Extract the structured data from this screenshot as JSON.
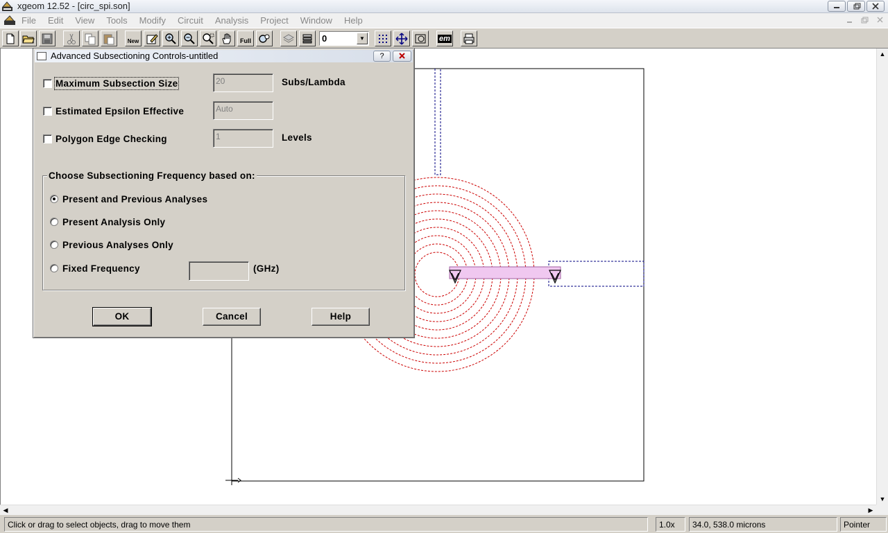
{
  "window": {
    "title": "xgeom 12.52 - [circ_spi.son]"
  },
  "menu": {
    "items": [
      "File",
      "Edit",
      "View",
      "Tools",
      "Modify",
      "Circuit",
      "Analysis",
      "Project",
      "Window",
      "Help"
    ]
  },
  "toolbar": {
    "zoom_value": "0",
    "new_label": "New",
    "full_label": "Full",
    "em_label": "em"
  },
  "dialog": {
    "title": "Advanced Subsectioning Controls-untitled",
    "help_glyph": "?",
    "options": [
      {
        "label": "Maximum Subsection Size",
        "value": "20",
        "unit": "Subs/Lambda",
        "checked": false
      },
      {
        "label": "Estimated Epsilon Effective",
        "value": "Auto",
        "unit": "",
        "checked": false
      },
      {
        "label": "Polygon Edge Checking",
        "value": "1",
        "unit": "Levels",
        "checked": false
      }
    ],
    "group_title": "Choose Subsectioning Frequency based on:",
    "radios": [
      {
        "label": "Present and Previous Analyses",
        "selected": true
      },
      {
        "label": "Present Analysis Only",
        "selected": false
      },
      {
        "label": "Previous Analyses Only",
        "selected": false
      },
      {
        "label": "Fixed Frequency",
        "selected": false
      }
    ],
    "fixed_frequency_value": "",
    "fixed_frequency_unit": "(GHz)",
    "buttons": {
      "ok": "OK",
      "cancel": "Cancel",
      "help": "Help"
    }
  },
  "status": {
    "message": "Click or drag to select objects, drag to move them",
    "zoom": "1.0x",
    "coords": "34.0, 538.0 microns",
    "mode": "Pointer"
  },
  "colors": {
    "spiral": "#cc0000",
    "outline": "#000080",
    "port_fill": "#f0c8f0"
  }
}
